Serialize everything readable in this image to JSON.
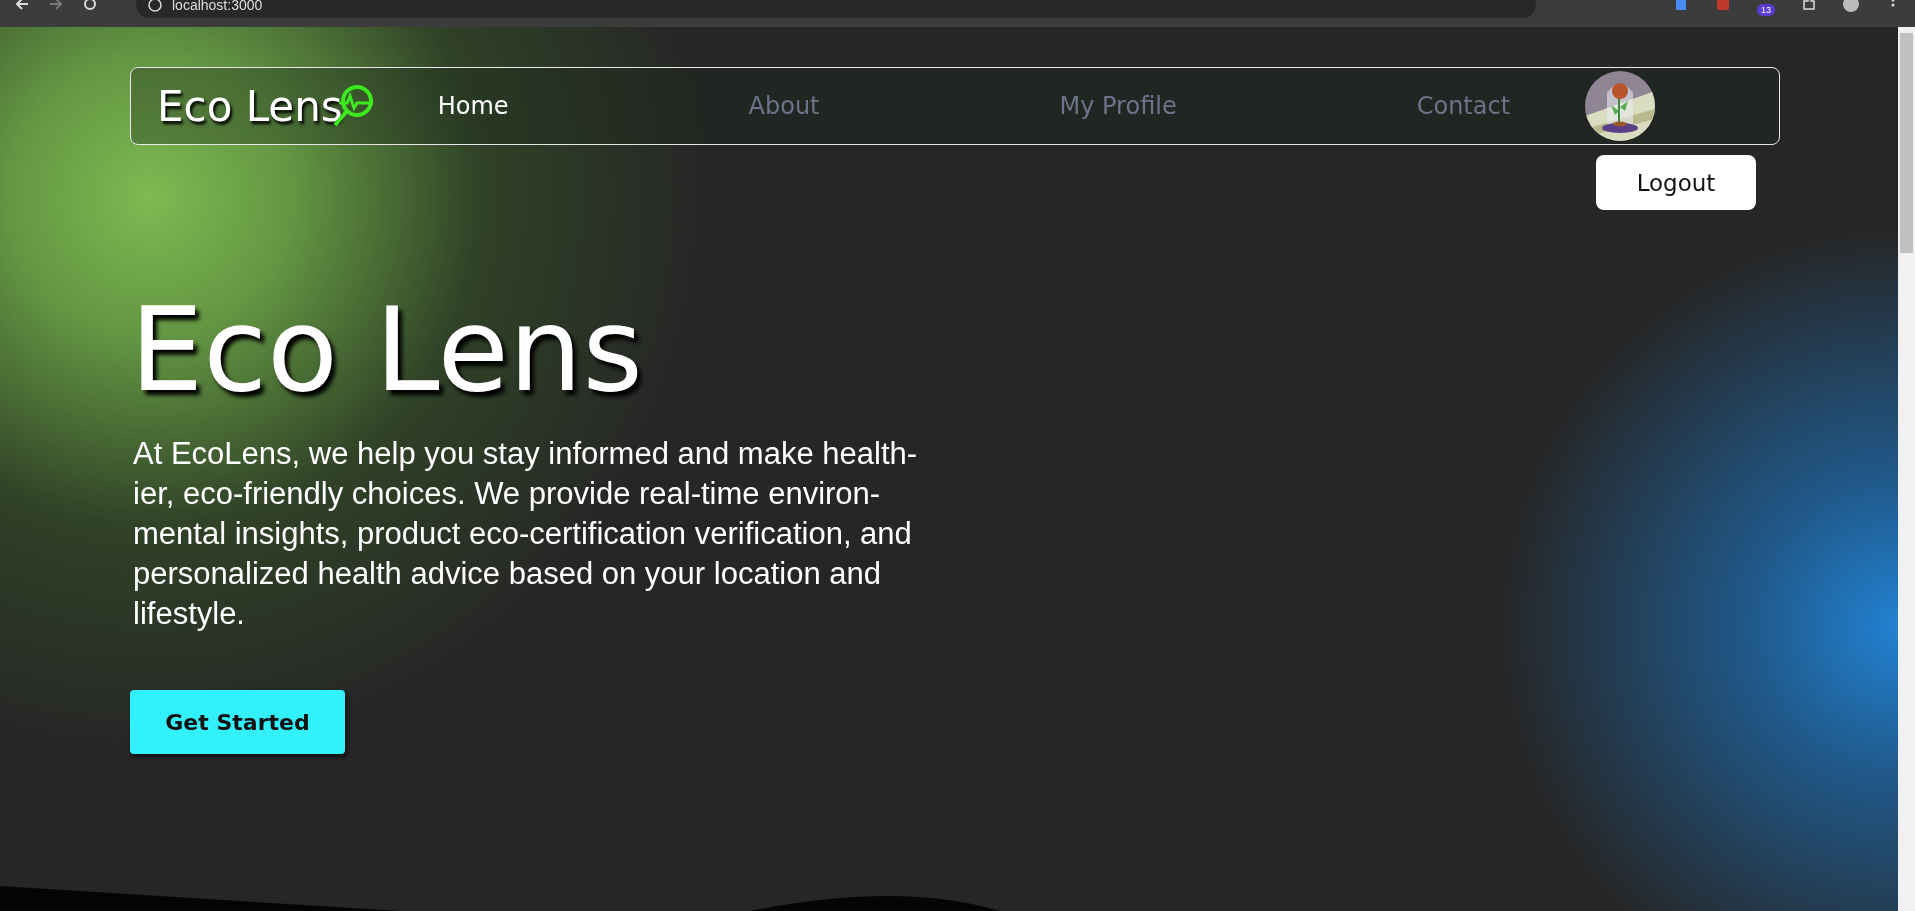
{
  "browser": {
    "url": "localhost:3000",
    "extension_badge": "13"
  },
  "nav": {
    "logo": "Eco Lens",
    "links": [
      {
        "label": "Home",
        "selected": true
      },
      {
        "label": "About",
        "selected": false
      },
      {
        "label": "My Profile",
        "selected": false
      },
      {
        "label": "Contact",
        "selected": false
      }
    ],
    "logout": "Logout"
  },
  "hero": {
    "title": "Eco Lens",
    "text": "At EcoLens, we help you stay informed and make health-ier, eco-friendly choices. We provide real-time environ-mental insights, product eco-certification verification, and personalized health advice based on your location and lifestyle.",
    "button": "Get Started"
  }
}
